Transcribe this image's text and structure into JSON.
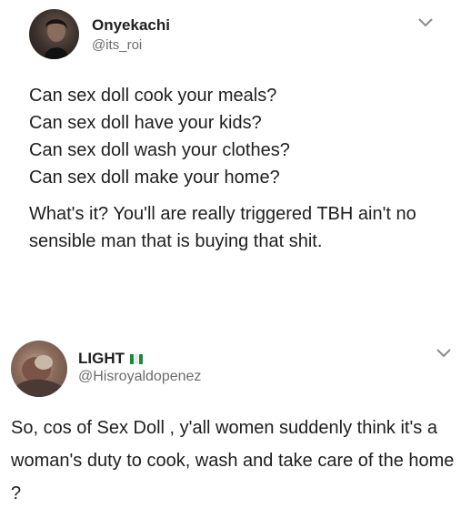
{
  "tweets": [
    {
      "name": "Onyekachi",
      "handle": "@its_roi",
      "lines": [
        "Can sex doll cook your meals?",
        "Can sex doll have your kids?",
        "Can sex doll wash your clothes?",
        "Can sex doll make your home?"
      ],
      "paragraph": "What's it? You'll are really triggered TBH ain't no sensible man that is buying that shit."
    },
    {
      "name": "LIGHT",
      "handle": "@Hisroyaldopenez",
      "text": "So, cos of Sex Doll , y'all women suddenly think it's a woman's duty to cook, wash and take care of the home ?"
    }
  ],
  "colors": {
    "text": "#1e1e1e",
    "handle": "#6b6b6b",
    "flag_green": "#1a8a3a"
  },
  "icons": {
    "menu": "chevron-down-icon",
    "flag": "nigeria-flag-icon"
  }
}
